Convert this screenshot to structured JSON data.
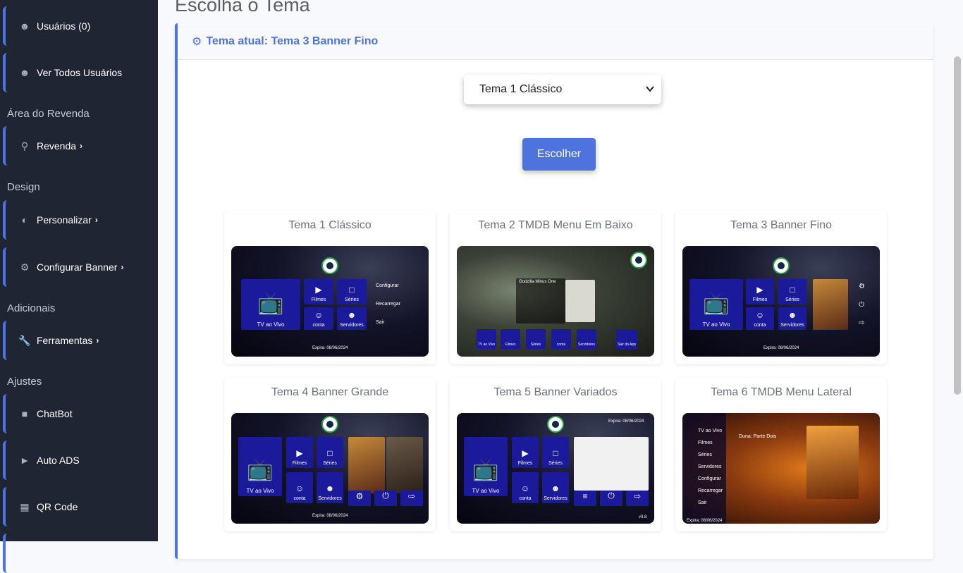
{
  "sidebar": {
    "items": [
      {
        "label": "Usuários (0)",
        "icon": "user-plus-icon"
      },
      {
        "label": "Ver Todos Usuários",
        "icon": "users-icon"
      },
      {
        "label": "Revenda",
        "icon": "search-icon",
        "chevron": "›"
      },
      {
        "label": "Personalizar",
        "icon": "half-circle-icon",
        "chevron": "›"
      },
      {
        "label": "Configurar Banner",
        "icon": "cogs-icon",
        "chevron": "›"
      },
      {
        "label": "Ferramentas",
        "icon": "wrench-icon",
        "chevron": "›"
      },
      {
        "label": "ChatBot",
        "icon": "robot-icon"
      },
      {
        "label": "Auto ADS",
        "icon": "megaphone-icon"
      },
      {
        "label": "QR Code",
        "icon": "qrcode-icon"
      }
    ],
    "sections": [
      "Área do Revenda",
      "Design",
      "Adicionais",
      "Ajustes"
    ]
  },
  "page": {
    "title": "Escolha o Tema",
    "current_theme": "Tema atual: Tema 3 Banner Fino",
    "select_value": "Tema 1 Clássico",
    "button": "Escolher"
  },
  "themes": [
    {
      "name": "Tema 1 Clássico"
    },
    {
      "name": "Tema 2 TMDB Menu Em Baixo"
    },
    {
      "name": "Tema 3 Banner Fino"
    },
    {
      "name": "Tema 4 Banner Grande"
    },
    {
      "name": "Tema 5 Banner Variados"
    },
    {
      "name": "Tema 6 TMDB Menu Lateral"
    }
  ],
  "preview": {
    "tv": "TV ao Vivo",
    "filmes": "Filmes",
    "series": "Séries",
    "conta": "conta",
    "servidores": "Servidores",
    "configurar": "Configurar",
    "recarregar": "Recarregar",
    "sair": "Sair",
    "sair_app": "Sair do App",
    "expira": "Expira: 08/06/2024",
    "version": "v3.8",
    "godzilla_title": "Godzilla Minus One",
    "dune_title": "Duna: Parte Dois"
  },
  "colors": {
    "accent": "#4e73df",
    "sidebar": "#1f2533",
    "tile": "#1a1a9a"
  }
}
